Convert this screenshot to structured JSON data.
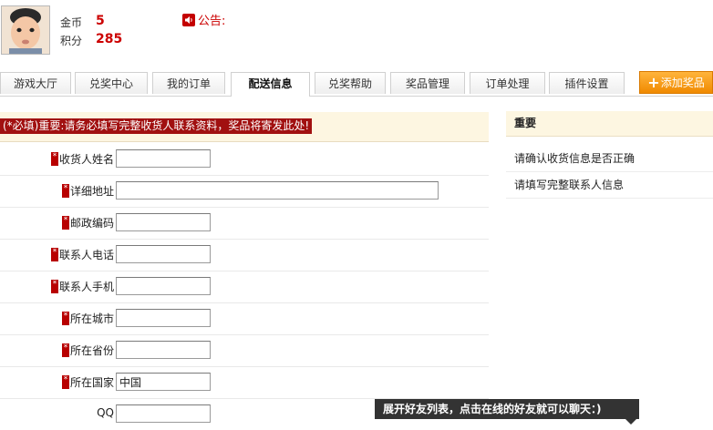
{
  "user": {
    "coins_label": "金币",
    "coins_value": "5",
    "points_label": "积分",
    "points_value": "285"
  },
  "notice": {
    "label": "公告:"
  },
  "tabs": [
    {
      "label": "游戏大厅",
      "active": false
    },
    {
      "label": "兑奖中心",
      "active": false
    },
    {
      "label": "我的订单",
      "active": false
    },
    {
      "label": "配送信息",
      "active": true
    },
    {
      "label": "兑奖帮助",
      "active": false
    },
    {
      "label": "奖品管理",
      "active": false
    },
    {
      "label": "订单处理",
      "active": false
    },
    {
      "label": "插件设置",
      "active": false
    }
  ],
  "add_prize_button": "添加奖品",
  "form": {
    "required_notice": "(*必填)重要:请务必填写完整收货人联系资料，奖品将寄发此处!",
    "fields": [
      {
        "label": "收货人姓名",
        "value": "",
        "required": true
      },
      {
        "label": "详细地址",
        "value": "",
        "required": true
      },
      {
        "label": "邮政编码",
        "value": "",
        "required": true
      },
      {
        "label": "联系人电话",
        "value": "",
        "required": true
      },
      {
        "label": "联系人手机",
        "value": "",
        "required": true
      },
      {
        "label": "所在城市",
        "value": "",
        "required": true
      },
      {
        "label": "所在省份",
        "value": "",
        "required": true
      },
      {
        "label": "所在国家",
        "value": "中国",
        "required": true
      },
      {
        "label": "QQ",
        "value": "",
        "required": false
      }
    ]
  },
  "sidebar": {
    "title": "重要",
    "items": [
      "请确认收货信息是否正确",
      "请填写完整联系人信息"
    ]
  },
  "toast": "展开好友列表，点击在线的好友就可以聊天：)",
  "colors": {
    "accent_red": "#cc0000",
    "tab_orange": "#f08a00",
    "notice_bg": "#fdf6e1"
  }
}
